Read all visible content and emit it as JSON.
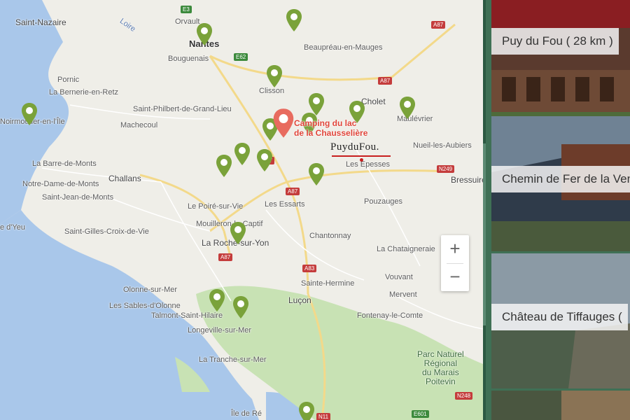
{
  "map": {
    "cities": {
      "nantes": "Nantes",
      "cholet": "Cholet",
      "saint_nazaire": "Saint-Nazaire",
      "orvault": "Orvault",
      "bouguenais": "Bouguenais",
      "challans": "Challans",
      "la_roche": "La Roche-sur-Yon",
      "lucon": "Luçon",
      "clisson": "Clisson",
      "bressuire": "Bressuire",
      "beaupreau": "Beaupréau-en-Mauges",
      "loire": "Loire",
      "pornic": "Pornic",
      "bernerie": "La Bernerie-en-Retz",
      "saint_philbert": "Saint-Philbert-de-Grand-Lieu",
      "machecoul": "Machecoul",
      "noirmoutier": "Noirmoutier-en-l'Île",
      "barre": "La Barre-de-Monts",
      "notre_dame": "Notre-Dame-de-Monts",
      "saint_jean": "Saint-Jean-de-Monts",
      "yeu": "e d'Yeu",
      "saint_gilles": "Saint-Gilles-Croix-de-Vie",
      "poire": "Le Poiré-sur-Vie",
      "mouilleron": "Mouilleron-le-Captif",
      "essarts": "Les Essarts",
      "epesses": "Les Epesses",
      "maulevrier": "Maulévrier",
      "nueil": "Nueil-les-Aubiers",
      "pouzauges": "Pouzauges",
      "chantonnay": "Chantonnay",
      "chataigneraie": "La Chataigneraie",
      "sainte_hermine": "Sainte-Hermine",
      "vouvant": "Vouvant",
      "mervent": "Mervent",
      "fontenay": "Fontenay-le-Comte",
      "olonne": "Olonne-sur-Mer",
      "sables": "Les Sables-d'Olonne",
      "talmont": "Talmont-Saint-Hilaire",
      "longeville": "Longeville-sur-Mer",
      "tranche": "La Tranche-sur-Mer",
      "re": "Île de Ré",
      "parc": "Parc Naturel\nRégional\ndu Marais\nPoitevin"
    },
    "roads": [
      "E3",
      "A87",
      "E62",
      "A87",
      "A87",
      "A87",
      "N249",
      "A83",
      "A87",
      "N248",
      "E601",
      "N11"
    ],
    "camping_label": "Camping du lac\nde la Chausselière",
    "logo_text": "PuyduFou.",
    "zoom_in": "+",
    "zoom_out": "−",
    "colors": {
      "pin": "#7aa23a",
      "camp": "#e86b5f",
      "water": "#a9c7ea",
      "green": "#c8e2b4"
    }
  },
  "sidebar": {
    "cards": [
      {
        "label": "Puy du Fou  ( 28 km )",
        "bg": "#5a3a2e"
      },
      {
        "label": "Chemin de Fer de la Ven",
        "bg": "#3f4e5e"
      },
      {
        "label": "Château de Tiffauges  (",
        "bg": "#4d5e4a"
      },
      {
        "label": "",
        "bg": "#4a5640"
      }
    ]
  }
}
